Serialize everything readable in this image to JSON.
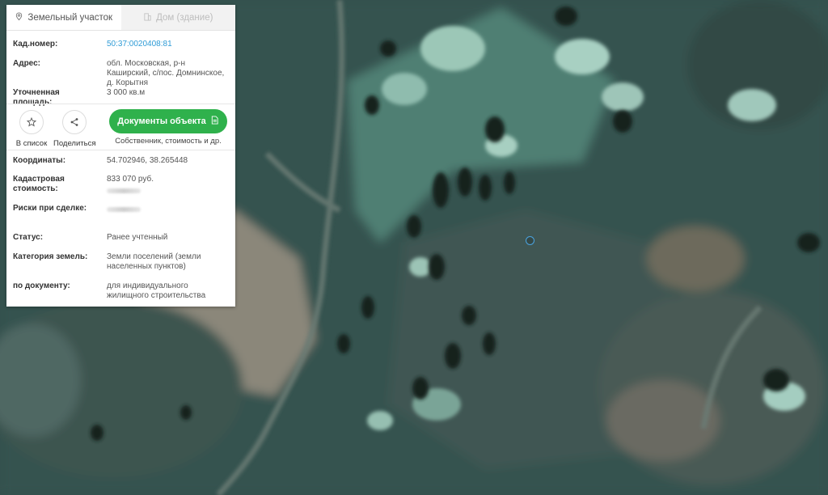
{
  "tabs": {
    "land": "Земельный участок",
    "house": "Дом (здание)"
  },
  "fields": {
    "cadastral_number_label": "Кад.номер:",
    "cadastral_number": "50:37:0020408:81",
    "address_label": "Адрес:",
    "address": "обл. Московская, р-н Каширский, с/пос. Домнинское, д. Корытня",
    "area_label": "Уточненная площадь:",
    "area": "3 000 кв.м",
    "coordinates_label": "Координаты:",
    "coordinates": "54.702946, 38.265448",
    "cadastral_value_label": "Кадастровая стоимость:",
    "cadastral_value": "833 070 руб.",
    "risks_label": "Риски при сделке:",
    "status_label": "Статус:",
    "status": "Ранее учтенный",
    "land_category_label": "Категория земель:",
    "land_category": "Земли поселений (земли населенных пунктов)",
    "by_document_label": "по документу:",
    "by_document": "для индивидуального жилищного строительства"
  },
  "actions": {
    "add_to_list": "В список",
    "share": "Поделиться",
    "documents_button": "Документы объекта",
    "documents_sub": "Собственник, стоимость и др."
  },
  "icons": [
    "pin-icon",
    "building-icon",
    "star-icon",
    "share-icon",
    "document-icon"
  ],
  "colors": {
    "accent_green": "#2fb14c",
    "link_blue": "#2e9bd6",
    "marker_blue": "#4aa3e0"
  }
}
